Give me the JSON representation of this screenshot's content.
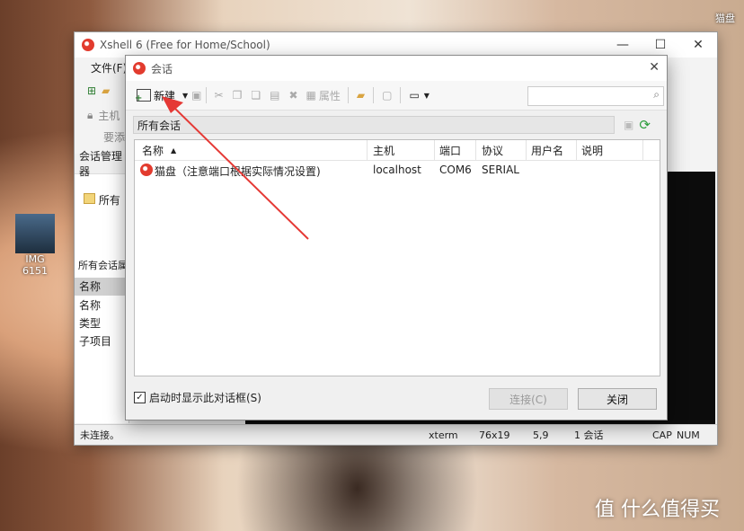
{
  "desktop": {
    "icon_label": "IMG 6151",
    "corner_label": "猫盘",
    "watermark": "值 什么值得买"
  },
  "main_window": {
    "title": "Xshell 6 (Free for Home/School)",
    "menu_file": "文件(F)",
    "session_manager": "会话管理器",
    "all_sessions": "所有",
    "host_prefix": "主机",
    "add_prefix": "要添",
    "properties_header": "所有会话属",
    "prop_rows": [
      "名称",
      "名称",
      "类型",
      "子项目"
    ],
    "status": {
      "left": "未连接。",
      "term": "xterm",
      "size": "76x19",
      "pos": "5,9",
      "sessions": "1 会话",
      "cap": "CAP",
      "num": "NUM"
    }
  },
  "dialog": {
    "title": "会话",
    "toolbar": {
      "new_label": "新建",
      "props_label": "属性"
    },
    "search_placeholder": "",
    "path": "所有会话",
    "columns": [
      "名称",
      "主机",
      "端口",
      "协议",
      "用户名",
      "说明"
    ],
    "rows": [
      {
        "name": "猫盘（注意端口根据实际情况设置)",
        "host": "localhost",
        "port": "COM6",
        "protocol": "SERIAL",
        "user": "",
        "note": ""
      }
    ],
    "startup_checkbox": {
      "label": "启动时显示此对话框(S)",
      "checked": true
    },
    "connect_button": "连接(C)",
    "close_button": "关闭"
  },
  "colors": {
    "accent_red": "#e53935",
    "brand_red": "#e23b2e"
  }
}
